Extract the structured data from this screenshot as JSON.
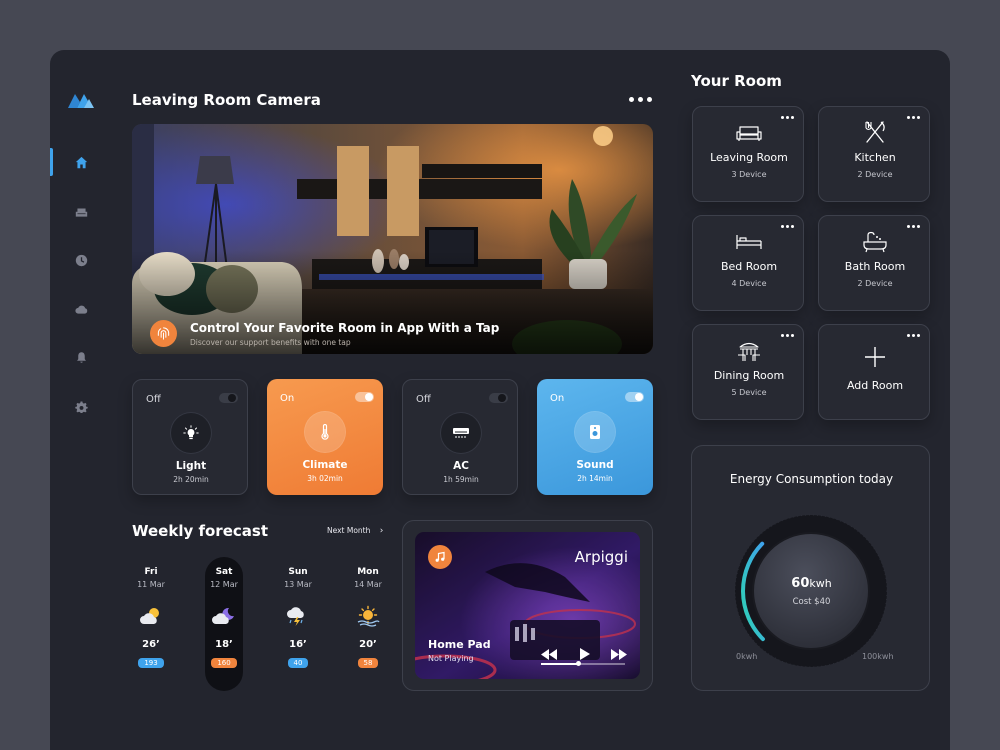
{
  "sidebar": {
    "items": [
      {
        "icon": "home-icon",
        "active": true
      },
      {
        "icon": "sofa-icon",
        "active": false
      },
      {
        "icon": "clock-icon",
        "active": false
      },
      {
        "icon": "cloud-icon",
        "active": false
      },
      {
        "icon": "bell-icon",
        "active": false
      },
      {
        "icon": "gear-icon",
        "active": false
      }
    ]
  },
  "camera": {
    "title": "Leaving Room Camera",
    "banner_title": "Control Your Favorite Room in App With a Tap",
    "banner_subtitle": "Discover our support benefits with one tap"
  },
  "devices": [
    {
      "state": "Off",
      "name": "Light",
      "time": "2h 20min",
      "on": false
    },
    {
      "state": "On",
      "name": "Climate",
      "time": "3h 02min",
      "on": true
    },
    {
      "state": "Off",
      "name": "AC",
      "time": "1h 59min",
      "on": false
    },
    {
      "state": "On",
      "name": "Sound",
      "time": "2h 14min",
      "on": true
    }
  ],
  "forecast": {
    "title": "Weekly forecast",
    "next_label": "Next Month",
    "days": [
      {
        "day": "Fri",
        "date": "11 Mar",
        "temp": "26’",
        "badge": "193",
        "badge_color": "#3fa3ec",
        "icon": "partly-cloudy-icon"
      },
      {
        "day": "Sat",
        "date": "12 Mar",
        "temp": "18’",
        "badge": "160",
        "badge_color": "#f0843d",
        "icon": "night-cloudy-icon",
        "selected": true
      },
      {
        "day": "Sun",
        "date": "13 Mar",
        "temp": "16’",
        "badge": "40",
        "badge_color": "#3fa3ec",
        "icon": "thunderstorm-icon"
      },
      {
        "day": "Mon",
        "date": "14 Mar",
        "temp": "20’",
        "badge": "58",
        "badge_color": "#f0843d",
        "icon": "sunny-icon"
      }
    ]
  },
  "music": {
    "title": "Arpiggi",
    "device": "Home Pad",
    "status": "Not Playing",
    "progress": 0.45
  },
  "rooms": {
    "title": "Your Room",
    "items": [
      {
        "name": "Leaving Room",
        "count": "3 Device",
        "icon": "sofa-icon"
      },
      {
        "name": "Kitchen",
        "count": "2 Device",
        "icon": "fork-knife-icon"
      },
      {
        "name": "Bed Room",
        "count": "4 Device",
        "icon": "bed-icon"
      },
      {
        "name": "Bath Room",
        "count": "2 Device",
        "icon": "bathtub-icon"
      },
      {
        "name": "Dining Room",
        "count": "5 Device",
        "icon": "dining-icon"
      },
      {
        "name": "Add Room",
        "count": "",
        "icon": "plus-icon"
      }
    ]
  },
  "energy": {
    "title": "Energy Consumption today",
    "value": "60",
    "unit": "kwh",
    "cost": "Cost $40",
    "min": "0kwh",
    "max": "100kwh",
    "fraction": 0.6,
    "accent": "#3fa3ec"
  },
  "colors": {
    "orange": "#f0843d",
    "blue": "#3fa3ec"
  }
}
